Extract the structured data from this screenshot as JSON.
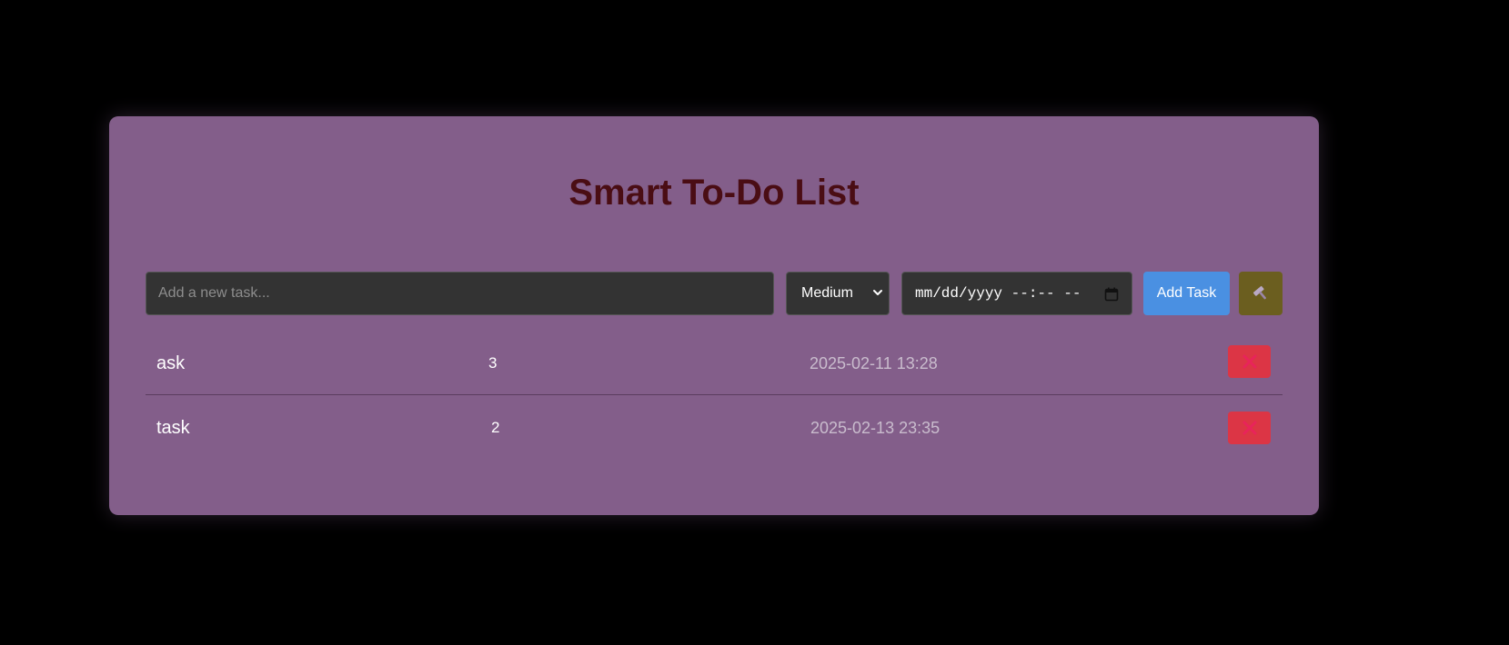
{
  "app": {
    "title": "Smart To-Do List"
  },
  "controls": {
    "task_placeholder": "Add a new task...",
    "task_value": "",
    "priority_selected": "Medium",
    "date_placeholder": "mm/dd/yyyy --:-- --",
    "add_label": "Add Task",
    "tool_icon": "hammer-icon"
  },
  "tasks": [
    {
      "name": "ask",
      "priority": "3",
      "due": "2025-02-11 13:28",
      "delete_icon": "close-icon"
    },
    {
      "name": "task",
      "priority": "2",
      "due": "2025-02-13 23:35",
      "delete_icon": "close-icon"
    }
  ],
  "colors": {
    "page_bg": "#000000",
    "card_bg": "#835e8a",
    "title": "#4a0d14",
    "input_bg": "#333333",
    "add_button": "#4a90e2",
    "tool_button": "#6b5e1f",
    "delete_button": "#dc3545",
    "delete_icon": "#e8245a"
  }
}
